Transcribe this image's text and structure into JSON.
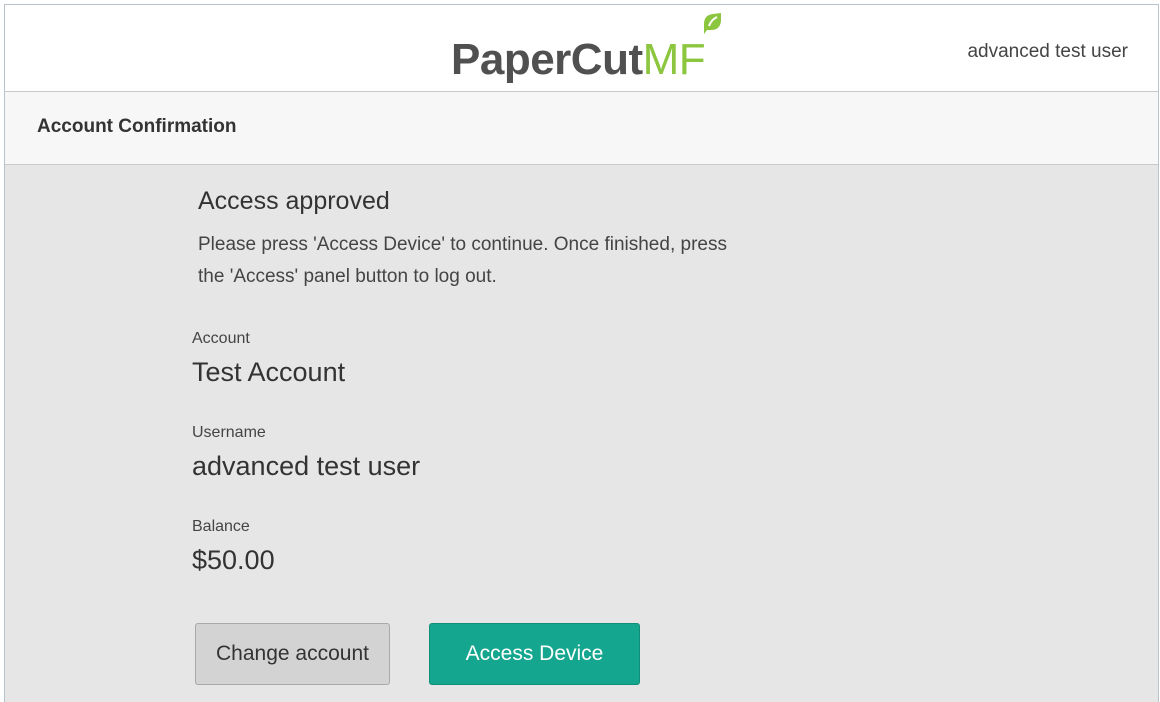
{
  "header": {
    "logo_brand": "PaperCut",
    "logo_suffix": "MF",
    "user_name": "advanced test user"
  },
  "page": {
    "title": "Account Confirmation"
  },
  "status": {
    "title": "Access approved",
    "message": "Please press 'Access Device' to continue. Once finished, press the 'Access' panel button to log out."
  },
  "fields": {
    "account": {
      "label": "Account",
      "value": "Test Account"
    },
    "username": {
      "label": "Username",
      "value": "advanced test user"
    },
    "balance": {
      "label": "Balance",
      "value": "$50.00"
    }
  },
  "actions": {
    "change_account_label": "Change account",
    "access_device_label": "Access Device"
  },
  "colors": {
    "brand_gray": "#505050",
    "brand_green": "#8cc63f",
    "primary_button": "#14a68e",
    "secondary_button": "#d3d3d3",
    "content_background": "#e6e6e6"
  },
  "icons": {
    "logo_leaf": "leaf-icon"
  }
}
